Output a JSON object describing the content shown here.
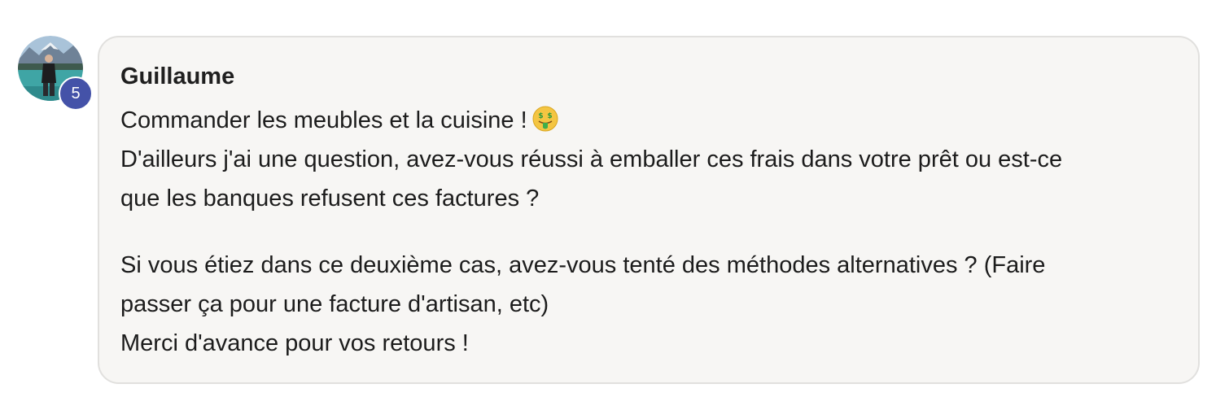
{
  "comment": {
    "author": "Guillaume",
    "badge_count": "5",
    "paragraphs": [
      {
        "lines": [
          "Commander les meubles et la cuisine !",
          "D'ailleurs j'ai une question, avez-vous réussi à emballer ces frais dans votre prêt ou est-ce",
          "que les banques refusent ces factures ?"
        ]
      },
      {
        "lines": [
          "Si vous étiez dans ce deuxième cas, avez-vous tenté des méthodes alternatives ? (Faire",
          "passer ça pour une facture d'artisan, etc)",
          "Merci d'avance pour vos retours !"
        ]
      }
    ],
    "emoji": "money-mouth-face-icon"
  },
  "colors": {
    "bubble_background": "#f7f6f4",
    "bubble_border": "#e1e0de",
    "badge": "#4452a8",
    "text": "#1c1c1c"
  }
}
